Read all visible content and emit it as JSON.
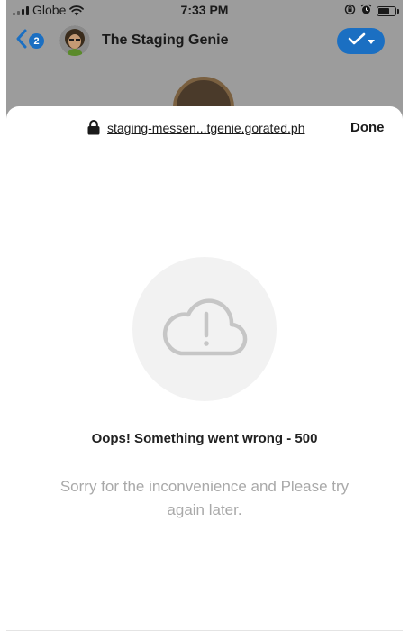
{
  "status_bar": {
    "carrier": "Globe",
    "time": "7:33 PM",
    "icons": [
      "signal-icon",
      "wifi-icon",
      "orientation-lock-icon",
      "alarm-icon",
      "battery-icon"
    ]
  },
  "messenger_header": {
    "back_badge_count": "2",
    "chat_title": "The Staging Genie",
    "accent_color": "#1b6fc2"
  },
  "browser_sheet": {
    "url": "staging-messen...tgenie.gorated.ph",
    "done_label": "Done"
  },
  "error": {
    "icon": "cloud-exclamation-icon",
    "title": "Oops! Something went wrong - 500",
    "message": "Sorry for the inconvenience and Please try again later."
  }
}
